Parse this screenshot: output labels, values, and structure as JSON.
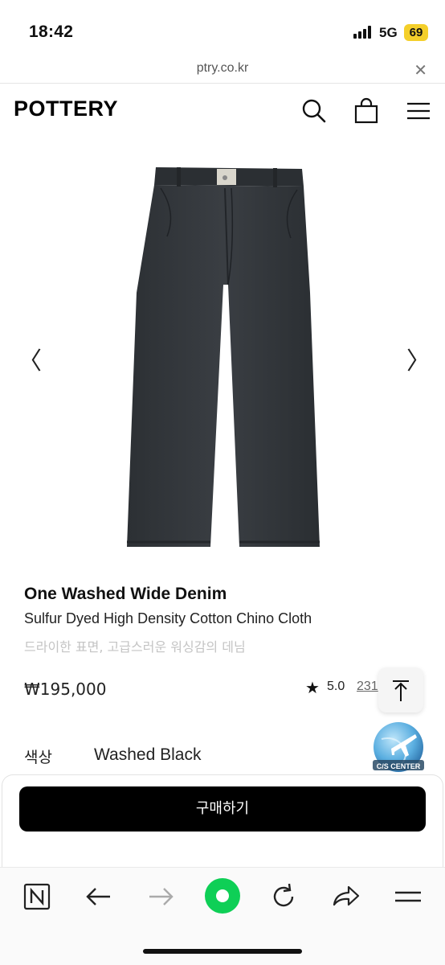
{
  "status": {
    "time": "18:42",
    "network": "5G",
    "battery": "69"
  },
  "browser": {
    "url": "ptry.co.kr",
    "close_icon": "close-icon"
  },
  "header": {
    "logo": "POTTERY",
    "icons": [
      "search-icon",
      "shopping-bag-icon",
      "menu-icon"
    ]
  },
  "gallery": {
    "prev": "〈",
    "next": "〉"
  },
  "product": {
    "name": "One Washed Wide Denim",
    "subtitle": "Sulfur Dyed High Density Cotton Chino Cloth",
    "description": "드라이한 표면, 고급스러운 워싱감의 데님",
    "price": "₩195,000",
    "rating_star": "★",
    "rating": "5.0",
    "review_count": "231",
    "color_label": "색상",
    "color_value": "Washed Black"
  },
  "cs_center": {
    "label": "C/S CENTER"
  },
  "purchase": {
    "buy_label": "구매하기"
  },
  "toolbar": {
    "items": [
      "naver-n-icon",
      "back-icon",
      "forward-icon",
      "green-home-icon",
      "refresh-icon",
      "share-icon",
      "menu-lines-icon"
    ]
  },
  "colors": {
    "accent_green": "#0ecf56",
    "battery_yellow": "#f4cf2a",
    "button_black": "#000000"
  }
}
